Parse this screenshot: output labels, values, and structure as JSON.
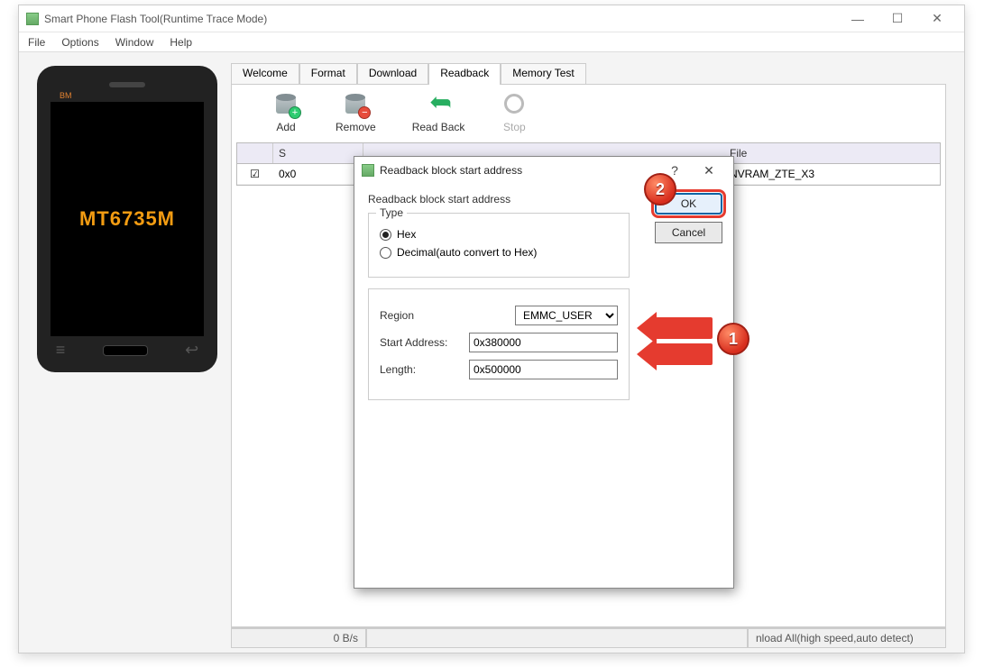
{
  "window": {
    "title": "Smart Phone Flash Tool(Runtime Trace Mode)"
  },
  "menubar": [
    "File",
    "Options",
    "Window",
    "Help"
  ],
  "phone": {
    "brand": "BM",
    "chip": "MT6735M"
  },
  "tabs": [
    {
      "label": "Welcome",
      "active": false
    },
    {
      "label": "Format",
      "active": false
    },
    {
      "label": "Download",
      "active": false
    },
    {
      "label": "Readback",
      "active": true
    },
    {
      "label": "Memory Test",
      "active": false
    }
  ],
  "toolbar": {
    "add": "Add",
    "remove": "Remove",
    "readback": "Read Back",
    "stop": "Stop"
  },
  "table": {
    "headers": {
      "check": "",
      "s": "S",
      "file": "File"
    },
    "row": {
      "checked": true,
      "start": "0x0",
      "file": "NVRAM_ZTE_X3"
    }
  },
  "dialog": {
    "title": "Readback block start address",
    "subtitle": "Readback block start address",
    "type_legend": "Type",
    "radio_hex": "Hex",
    "radio_dec": "Decimal(auto convert to Hex)",
    "region_label": "Region",
    "region_value": "EMMC_USER",
    "start_label": "Start Address:",
    "start_value": "0x380000",
    "length_label": "Length:",
    "length_value": "0x500000",
    "ok": "OK",
    "cancel": "Cancel",
    "help": "?",
    "close": "✕"
  },
  "statusbar": {
    "speed": "0 B/s",
    "mode": "nload All(high speed,auto detect)"
  },
  "callouts": {
    "one": "1",
    "two": "2"
  }
}
